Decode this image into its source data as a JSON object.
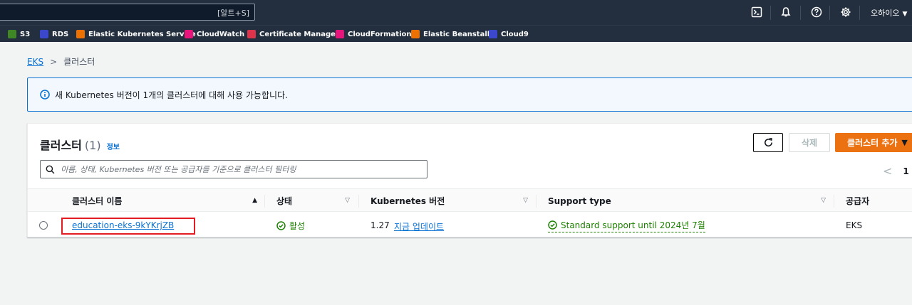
{
  "topnav": {
    "search_shortcut": "[알트+S]",
    "region_label": "오하이오"
  },
  "favorites": [
    {
      "label": "S3",
      "color": "#3f8624"
    },
    {
      "label": "RDS",
      "color": "#3b48cc"
    },
    {
      "label": "Elastic Kubernetes Service",
      "color": "#ed7100"
    },
    {
      "label": "CloudWatch",
      "color": "#e7157b"
    },
    {
      "label": "Certificate Manager",
      "color": "#dd344c"
    },
    {
      "label": "CloudFormation",
      "color": "#e7157b"
    },
    {
      "label": "Elastic Beanstalk",
      "color": "#ed7100"
    },
    {
      "label": "Cloud9",
      "color": "#3b48cc"
    }
  ],
  "breadcrumb": {
    "root": "EKS",
    "current": "클러스터"
  },
  "alert": {
    "text": "새 Kubernetes 버전이 1개의 클러스터에 대해 사용 가능합니다."
  },
  "panel": {
    "title": "클러스터",
    "count": "(1)",
    "info_link": "정보",
    "delete_label": "삭제",
    "add_label": "클러스터 추가",
    "filter_placeholder": "이름, 상태, Kubernetes 버전 또는 공급자를 기준으로 클러스터 필터링",
    "page_number": "1"
  },
  "table": {
    "columns": [
      "클러스터 이름",
      "상태",
      "Kubernetes 버전",
      "Support type",
      "공급자"
    ],
    "rows": [
      {
        "name": "education-eks-9kYKrjZB",
        "status": "활성",
        "version": "1.27",
        "update_link": "지금 업데이트",
        "support": "Standard support until 2024년 7월",
        "provider": "EKS"
      }
    ]
  },
  "colors": {
    "accent": "#0972d3",
    "primary_button": "#ec7211",
    "success": "#1d8102",
    "highlight_box": "#e31b23",
    "nav_bg": "#232f3e"
  }
}
